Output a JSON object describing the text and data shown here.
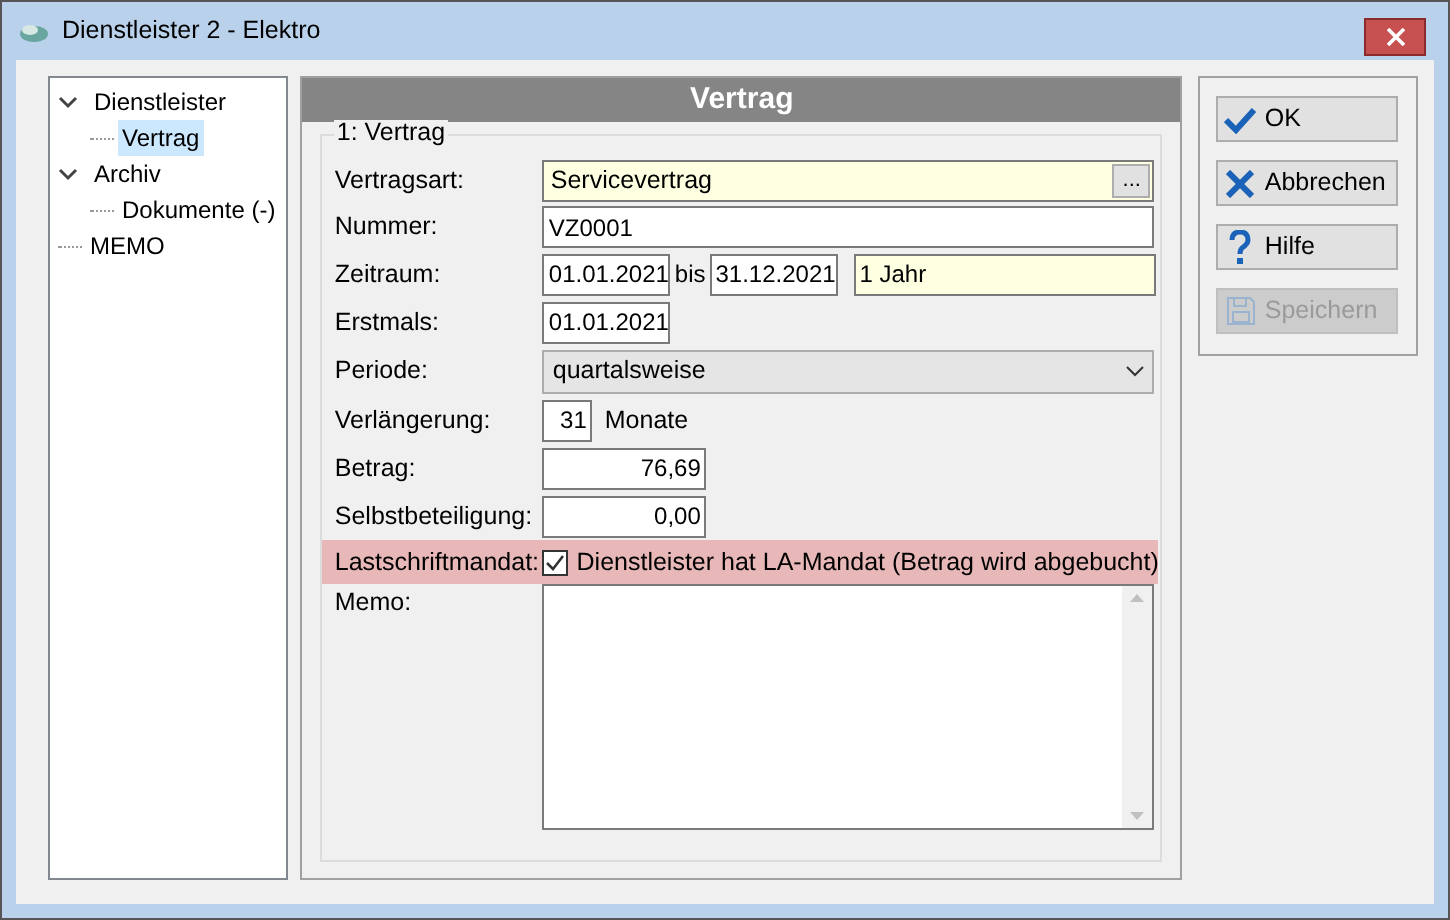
{
  "window": {
    "title": "Dienstleister 2 - Elektro"
  },
  "tree": [
    {
      "label": "Dienstleister",
      "selected": false,
      "expanded": true,
      "children": [
        {
          "label": "Vertrag",
          "selected": true
        }
      ]
    },
    {
      "label": "Archiv",
      "selected": false,
      "expanded": true,
      "children": [
        {
          "label": "Dokumente (-)",
          "selected": false
        }
      ]
    },
    {
      "label": "MEMO",
      "selected": false
    }
  ],
  "panel": {
    "header": "Vertrag",
    "group": "1: Vertrag"
  },
  "fields": [
    {
      "kind": "lookup",
      "label": "Vertragsart:",
      "value": "Servicevertrag",
      "required": true,
      "button": "..."
    },
    {
      "kind": "text",
      "label": "Nummer:",
      "value": "VZ0001",
      "required": false
    },
    {
      "kind": "range",
      "label": "Zeitraum:",
      "from": "01.01.2021",
      "separator": "bis",
      "to": "31.12.2021",
      "duration": "1 Jahr",
      "required": true
    },
    {
      "kind": "date",
      "label": "Erstmals:",
      "value": "01.01.2021",
      "required": false
    },
    {
      "kind": "select",
      "label": "Periode:",
      "value": "quartalsweise"
    },
    {
      "kind": "number_unit",
      "label": "Verlängerung:",
      "value": "31",
      "unit": "Monate"
    },
    {
      "kind": "amount",
      "label": "Betrag:",
      "value": "76,69"
    },
    {
      "kind": "amount",
      "label": "Selbstbeteiligung:",
      "value": "0,00"
    },
    {
      "kind": "checkbox",
      "label": "Lastschriftmandat:",
      "text": "Dienstleister hat LA-Mandat (Betrag wird abgebucht)",
      "checked": true,
      "highlighted": true
    },
    {
      "kind": "memo",
      "label": "Memo:"
    }
  ],
  "buttons": [
    {
      "label": "OK",
      "disabled": false
    },
    {
      "label": "Abbrechen",
      "disabled": false
    },
    {
      "label": "Hilfe",
      "disabled": false
    },
    {
      "label": "Speichern",
      "disabled": true
    }
  ]
}
